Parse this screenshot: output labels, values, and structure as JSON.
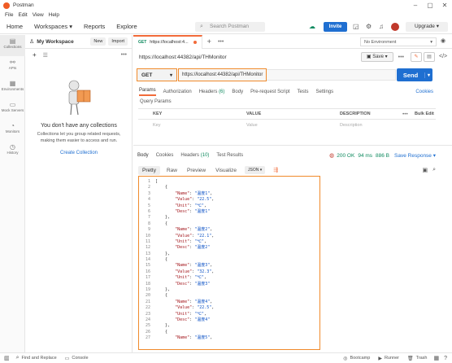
{
  "window": {
    "title": "Postman"
  },
  "menu": [
    "File",
    "Edit",
    "View",
    "Help"
  ],
  "header": {
    "home": "Home",
    "workspaces": "Workspaces",
    "reports": "Reports",
    "explore": "Explore",
    "search_placeholder": "Search Postman",
    "invite": "Invite",
    "upgrade": "Upgrade"
  },
  "rail": [
    {
      "label": "Collections",
      "icon": "collections-icon",
      "glyph": "▤"
    },
    {
      "label": "APIs",
      "icon": "apis-icon",
      "glyph": "⚯"
    },
    {
      "label": "Environments",
      "icon": "environments-icon",
      "glyph": "▦"
    },
    {
      "label": "Mock Servers",
      "icon": "mock-servers-icon",
      "glyph": "▭"
    },
    {
      "label": "Monitors",
      "icon": "monitors-icon",
      "glyph": "◔"
    },
    {
      "label": "History",
      "icon": "history-icon",
      "glyph": "◷"
    }
  ],
  "sidebar": {
    "workspace": "My Workspace",
    "new": "New",
    "import": "Import",
    "empty_title": "You don't have any collections",
    "empty_sub_1": "Collections let you group related requests,",
    "empty_sub_2": "making them easier to access and run.",
    "create": "Create Collection"
  },
  "tabs": {
    "method": "GET",
    "title": "https://localhost:4...",
    "environment": "No Environment"
  },
  "request": {
    "name": "https://localhost:44382/api/THMonitor",
    "save": "Save",
    "method": "GET",
    "url": "https://localhost:44382/api/THMonitor",
    "send": "Send",
    "tabs": [
      "Params",
      "Authorization",
      "Headers (6)",
      "Body",
      "Pre-request Script",
      "Tests",
      "Settings"
    ],
    "cookies": "Cookies",
    "query_params": "Query Params",
    "columns": {
      "key": "KEY",
      "value": "VALUE",
      "description": "DESCRIPTION",
      "bulk": "Bulk Edit"
    },
    "placeholders": {
      "key": "Key",
      "value": "Value",
      "description": "Description"
    }
  },
  "response": {
    "tabs": [
      "Body",
      "Cookies",
      "Headers (10)",
      "Test Results"
    ],
    "status": "200 OK",
    "time": "94 ms",
    "size": "886 B",
    "save": "Save Response",
    "views": [
      "Pretty",
      "Raw",
      "Preview",
      "Visualize"
    ],
    "format": "JSON",
    "lines": [
      {
        "n": "1",
        "t": "["
      },
      {
        "n": "2",
        "t": "    {"
      },
      {
        "n": "3",
        "k": "\"Name\"",
        "v": "\"温度1\"",
        "c": ","
      },
      {
        "n": "4",
        "k": "\"Value\"",
        "v": "\"22.5\"",
        "c": ","
      },
      {
        "n": "5",
        "k": "\"Unit\"",
        "v": "\"℃\"",
        "c": ","
      },
      {
        "n": "6",
        "k": "\"Desc\"",
        "v": "\"温度1\"",
        "c": ""
      },
      {
        "n": "7",
        "t": "    },"
      },
      {
        "n": "8",
        "t": "    {"
      },
      {
        "n": "9",
        "k": "\"Name\"",
        "v": "\"温度2\"",
        "c": ","
      },
      {
        "n": "10",
        "k": "\"Value\"",
        "v": "\"22.1\"",
        "c": ","
      },
      {
        "n": "11",
        "k": "\"Unit\"",
        "v": "\"℃\"",
        "c": ","
      },
      {
        "n": "12",
        "k": "\"Desc\"",
        "v": "\"温度2\"",
        "c": ""
      },
      {
        "n": "13",
        "t": "    },"
      },
      {
        "n": "14",
        "t": "    {"
      },
      {
        "n": "15",
        "k": "\"Name\"",
        "v": "\"温度3\"",
        "c": ","
      },
      {
        "n": "16",
        "k": "\"Value\"",
        "v": "\"32.3\"",
        "c": ","
      },
      {
        "n": "17",
        "k": "\"Unit\"",
        "v": "\"℃\"",
        "c": ","
      },
      {
        "n": "18",
        "k": "\"Desc\"",
        "v": "\"温度3\"",
        "c": ""
      },
      {
        "n": "19",
        "t": "    },"
      },
      {
        "n": "20",
        "t": "    {"
      },
      {
        "n": "21",
        "k": "\"Name\"",
        "v": "\"温度4\"",
        "c": ","
      },
      {
        "n": "22",
        "k": "\"Value\"",
        "v": "\"22.5\"",
        "c": ","
      },
      {
        "n": "23",
        "k": "\"Unit\"",
        "v": "\"℃\"",
        "c": ","
      },
      {
        "n": "24",
        "k": "\"Desc\"",
        "v": "\"温度4\"",
        "c": ""
      },
      {
        "n": "25",
        "t": "    },"
      },
      {
        "n": "26",
        "t": "    {"
      },
      {
        "n": "27",
        "k": "\"Name\"",
        "v": "\"温度5\"",
        "c": ","
      }
    ]
  },
  "footer": {
    "find": "Find and Replace",
    "console": "Console",
    "bootcamp": "Bootcamp",
    "runner": "Runner",
    "trash": "Trash"
  },
  "colors": {
    "accent": "#f26b3a",
    "primary": "#1f6fd1",
    "highlight": "#f08a2b"
  }
}
